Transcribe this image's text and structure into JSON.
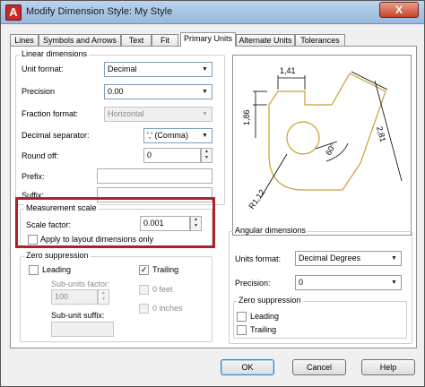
{
  "window": {
    "title": "Modify Dimension Style: My Style",
    "close_label": "X",
    "app_icon_label": "A"
  },
  "tabs": [
    {
      "label": "Lines",
      "active": false
    },
    {
      "label": "Symbols and Arrows",
      "active": false
    },
    {
      "label": "Text",
      "active": false
    },
    {
      "label": "Fit",
      "active": false
    },
    {
      "label": "Primary Units",
      "active": true
    },
    {
      "label": "Alternate Units",
      "active": false
    },
    {
      "label": "Tolerances",
      "active": false
    }
  ],
  "linear": {
    "group_label": "Linear dimensions",
    "unit_format": {
      "label": "Unit format:",
      "value": "Decimal"
    },
    "precision": {
      "label": "Precision",
      "value": "0.00"
    },
    "fraction_format": {
      "label": "Fraction format:",
      "value": "Horizontal"
    },
    "decimal_separator": {
      "label": "Decimal separator:",
      "value": "','  (Comma)"
    },
    "round_off": {
      "label": "Round off:",
      "value": "0"
    },
    "prefix": {
      "label": "Prefix:",
      "value": ""
    },
    "suffix": {
      "label": "Suffix:",
      "value": ""
    }
  },
  "measurement": {
    "group_label": "Measurement scale",
    "scale_factor_label": "Scale factor:",
    "scale_factor_value": "0.001",
    "apply_layout_label": "Apply to layout dimensions only",
    "apply_layout_checked": false
  },
  "zero_linear": {
    "group_label": "Zero suppression",
    "leading_label": "Leading",
    "leading_checked": false,
    "trailing_label": "Trailing",
    "trailing_checked": true,
    "sub_units_factor_label": "Sub-units factor:",
    "sub_units_factor_value": "100",
    "zero_feet_label": "0 feet",
    "zero_inches_label": "0 inches",
    "sub_unit_suffix_label": "Sub-unit suffix:",
    "sub_unit_suffix_value": "",
    "check_mark": "✓"
  },
  "angular": {
    "group_label": "Angular dimensions",
    "units_format_label": "Units format:",
    "units_format_value": "Decimal Degrees",
    "precision_label": "Precision:",
    "precision_value": "0",
    "zero_group_label": "Zero suppression",
    "leading_label": "Leading",
    "leading_checked": false,
    "trailing_label": "Trailing",
    "trailing_checked": false
  },
  "preview": {
    "dim_top": "1,41",
    "dim_left": "1,86",
    "dim_right": "2,81",
    "angle": "60°",
    "radius": "R1,12"
  },
  "buttons": {
    "ok": "OK",
    "cancel": "Cancel",
    "help": "Help"
  },
  "icons": {
    "dropdown": "▼",
    "spin_up": "▲",
    "spin_down": "▼"
  }
}
